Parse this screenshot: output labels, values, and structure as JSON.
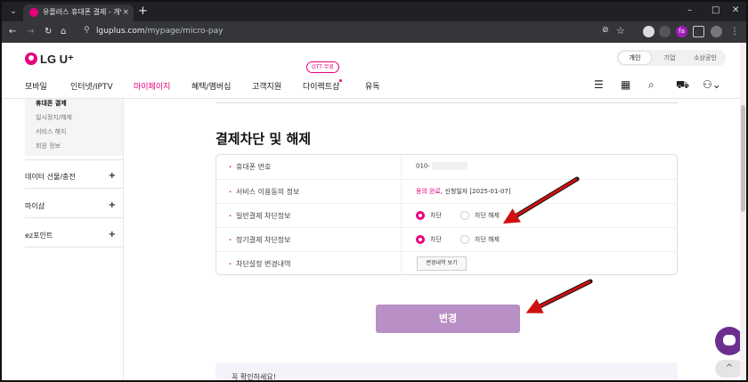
{
  "browser": {
    "tab_title": "유플러스 휴대폰 결제 - 개인 |",
    "tab_close": "×",
    "new_tab": "+",
    "tab_list": "⌄",
    "url_host": "lguplus.com",
    "url_path": "/mypage/micro-pay",
    "nav_back": "←",
    "nav_forward": "→",
    "nav_reload": "↻",
    "nav_home": "⌂",
    "win_min": "–",
    "win_max": "□",
    "win_close": "✕",
    "star": "☆"
  },
  "site": {
    "logo_text": "LG U⁺",
    "segments": [
      "개인",
      "기업",
      "소상공인"
    ],
    "gnb": [
      "모바일",
      "인터넷/IPTV",
      "마이페이지",
      "혜택/멤버십",
      "고객지원",
      "다이렉트샵",
      "유독"
    ],
    "gnb_active": "마이페이지",
    "ott_badge": "OTT 무료",
    "brand_color": "#e6007e"
  },
  "sidebar": {
    "sub_items": [
      "휴대폰 결제",
      "일시정지/해제",
      "서비스 해지",
      "회원 정보"
    ],
    "current": "휴대폰 결제",
    "menus": [
      {
        "label": "데이터 선물/충전",
        "plus": "+"
      },
      {
        "label": "마이샵",
        "plus": "+"
      },
      {
        "label": "ez포인트",
        "plus": "+"
      }
    ]
  },
  "main": {
    "title": "결제차단 및 해제",
    "rows": [
      {
        "label": "휴대폰 번호",
        "value": "010-"
      },
      {
        "label": "서비스 이용동의 정보",
        "consent": "동의 완료",
        "date_text": ", 신청일자 [2025-01-07]"
      },
      {
        "label": "일반결제 차단정보",
        "opt_block": "차단",
        "opt_unblock": "차단 해제"
      },
      {
        "label": "정기결제 차단정보",
        "opt_block": "차단",
        "opt_unblock": "차단 해제"
      },
      {
        "label": "차단설정 변경내역",
        "button": "변경내역 보기"
      }
    ],
    "change_button": "변경",
    "faq_title": "꼭 확인하세요!"
  },
  "floating": {
    "totop": "^"
  }
}
